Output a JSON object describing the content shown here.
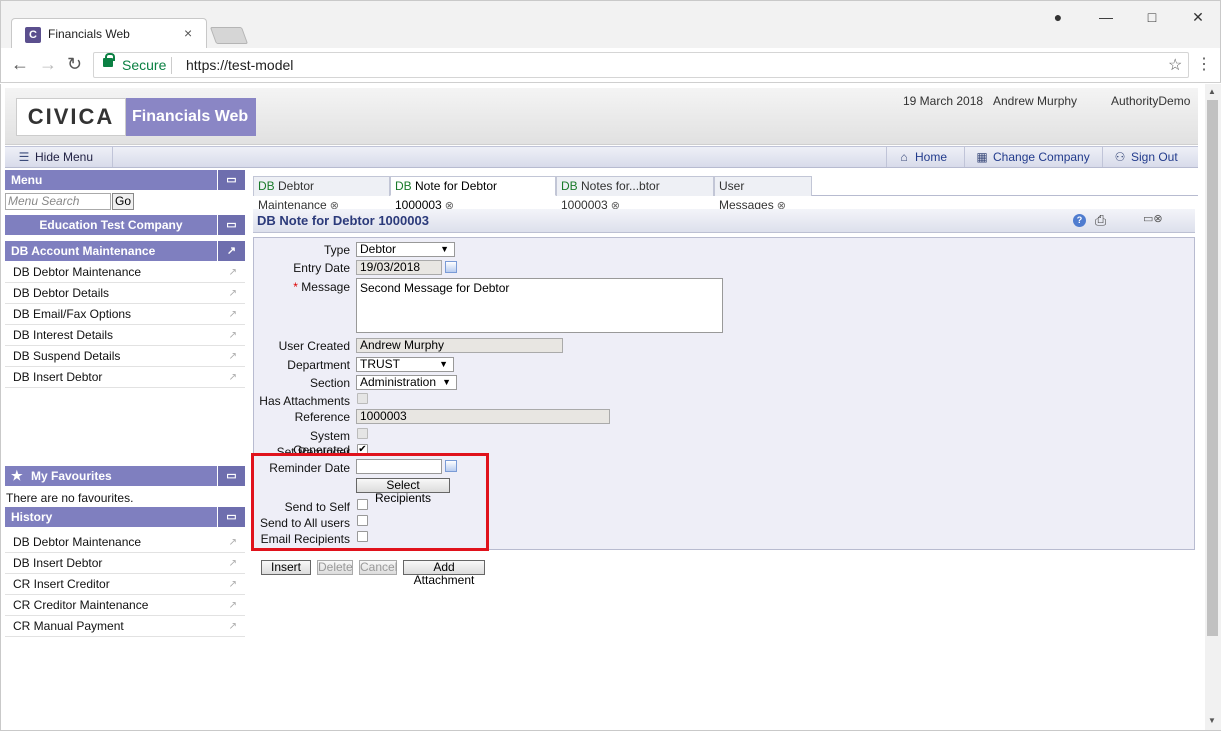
{
  "browser": {
    "tab_title": "Financials Web",
    "tab_favicon_letter": "C",
    "secure_label": "Secure",
    "url": "https://test-model",
    "window_controls": [
      "account-icon",
      "minimize-icon",
      "maximize-icon",
      "close-icon"
    ]
  },
  "header": {
    "logo": "CIVICA",
    "brand": "Financials Web",
    "date": "19 March 2018",
    "user": "Andrew Murphy",
    "authority": "AuthorityDemo"
  },
  "toolbar": {
    "hide_menu": "Hide Menu",
    "home": "Home",
    "change_company": "Change Company",
    "sign_out": "Sign Out"
  },
  "menu": {
    "title": "Menu",
    "search_placeholder": "Menu Search",
    "go": "Go",
    "company": "Education Test Company",
    "section_title": "DB Account Maintenance",
    "items": [
      {
        "label": "DB Debtor Maintenance"
      },
      {
        "label": "DB Debtor Details"
      },
      {
        "label": "DB Email/Fax Options"
      },
      {
        "label": "DB Interest Details"
      },
      {
        "label": "DB Suspend Details"
      },
      {
        "label": "DB Insert Debtor"
      }
    ],
    "favourites_title": "My Favourites",
    "favourites_empty": "There are no favourites.",
    "history_title": "History",
    "history": [
      {
        "label": "DB Debtor Maintenance"
      },
      {
        "label": "DB Insert Debtor"
      },
      {
        "label": "CR Insert Creditor"
      },
      {
        "label": "CR Creditor Maintenance"
      },
      {
        "label": "CR Manual Payment"
      }
    ]
  },
  "tabs": [
    {
      "prefix": "DB",
      "label": "Debtor Maintenance"
    },
    {
      "prefix": "DB",
      "label": "Note for Debtor 1000003"
    },
    {
      "prefix": "DB",
      "label": "Notes for...btor 1000003"
    },
    {
      "prefix": "",
      "label": "User Messages"
    }
  ],
  "form": {
    "title": "DB Note for Debtor 1000003",
    "type_label": "Type",
    "type_value": "Debtor",
    "entry_date_label": "Entry Date",
    "entry_date_value": "19/03/2018",
    "required_mark": "*",
    "message_label": "Message",
    "message_value": "Second Message for Debtor",
    "user_created_label": "User Created",
    "user_created_value": "Andrew Murphy",
    "department_label": "Department",
    "department_value": "TRUST",
    "section_label": "Section",
    "section_value": "Administration",
    "has_attachments_label": "Has Attachments",
    "reference_label": "Reference",
    "reference_value": "1000003",
    "system_generated_label": "System Generated",
    "set_reminder_label": "Set Reminder",
    "reminder_date_label": "Reminder Date",
    "reminder_date_value": "",
    "select_recipients": "Select Recipients",
    "send_to_self_label": "Send to Self",
    "send_to_all_label": "Send to All users",
    "email_recipients_label": "Email Recipients",
    "buttons": {
      "insert": "Insert",
      "delete": "Delete",
      "cancel": "Cancel",
      "add_attachment": "Add Attachment"
    }
  },
  "colors": {
    "accent": "#7f7fbf",
    "highlight": "#e0121c",
    "secure": "#0b8043"
  }
}
